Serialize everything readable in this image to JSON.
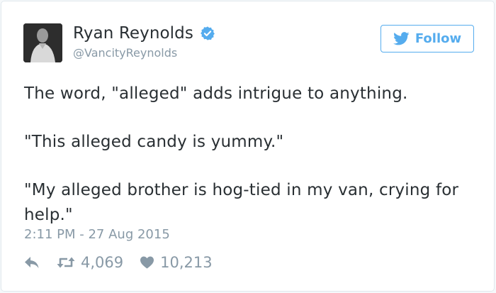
{
  "author": {
    "display_name": "Ryan Reynolds",
    "handle": "@VancityReynolds",
    "verified": true
  },
  "follow_button": {
    "label": "Follow",
    "icon": "twitter-bird-icon"
  },
  "tweet": {
    "lines": [
      "The word, \"alleged\" adds intrigue to anything.",
      "\"This alleged candy is yummy.\"",
      "\"My alleged brother is hog-tied in my van, crying for help.\""
    ],
    "timestamp": "2:11 PM - 27 Aug 2015"
  },
  "stats": {
    "retweets": "4,069",
    "likes": "10,213"
  },
  "colors": {
    "accent": "#55acee",
    "text": "#292f33",
    "muted": "#8899a6",
    "border": "#e1e8ed"
  }
}
